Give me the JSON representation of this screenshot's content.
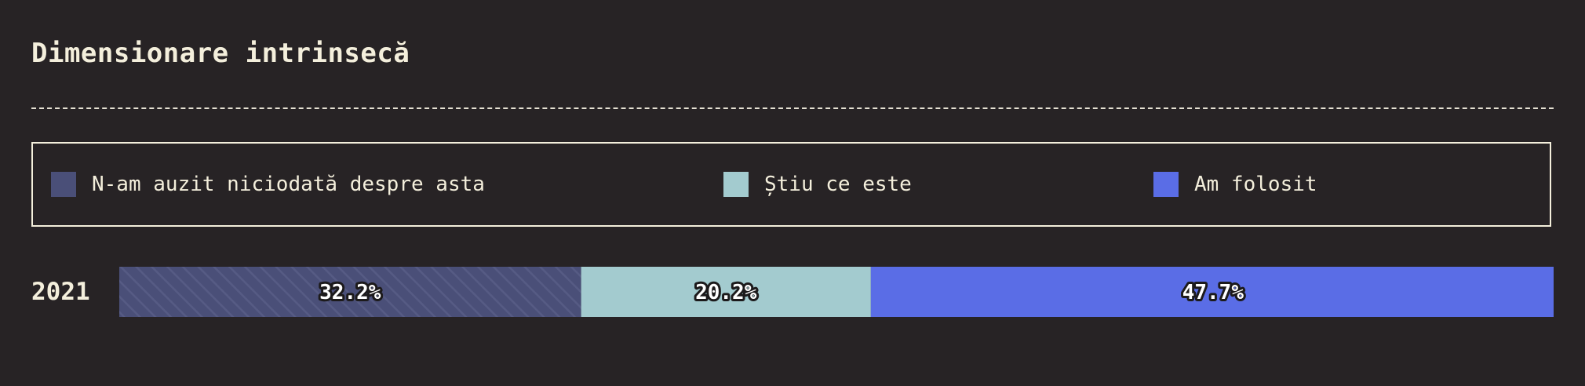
{
  "title": "Dimensionare intrinsecă",
  "legend": [
    {
      "label": "N-am auzit niciodată despre asta",
      "color": "#4a4f78",
      "pattern": "hatched"
    },
    {
      "label": "Știu ce este",
      "color": "#a3cbcf"
    },
    {
      "label": "Am folosit",
      "color": "#5a6de6"
    }
  ],
  "chart_data": {
    "type": "bar",
    "orientation": "horizontal-stacked-100",
    "categories": [
      "2021"
    ],
    "series": [
      {
        "name": "N-am auzit niciodată despre asta",
        "values": [
          32.2
        ],
        "label": "32.2%",
        "color": "#4a4f78"
      },
      {
        "name": "Știu ce este",
        "values": [
          20.2
        ],
        "label": "20.2%",
        "color": "#a3cbcf"
      },
      {
        "name": "Am folosit",
        "values": [
          47.7
        ],
        "label": "47.7%",
        "color": "#5a6de6"
      }
    ],
    "xlim": [
      0,
      100
    ]
  }
}
